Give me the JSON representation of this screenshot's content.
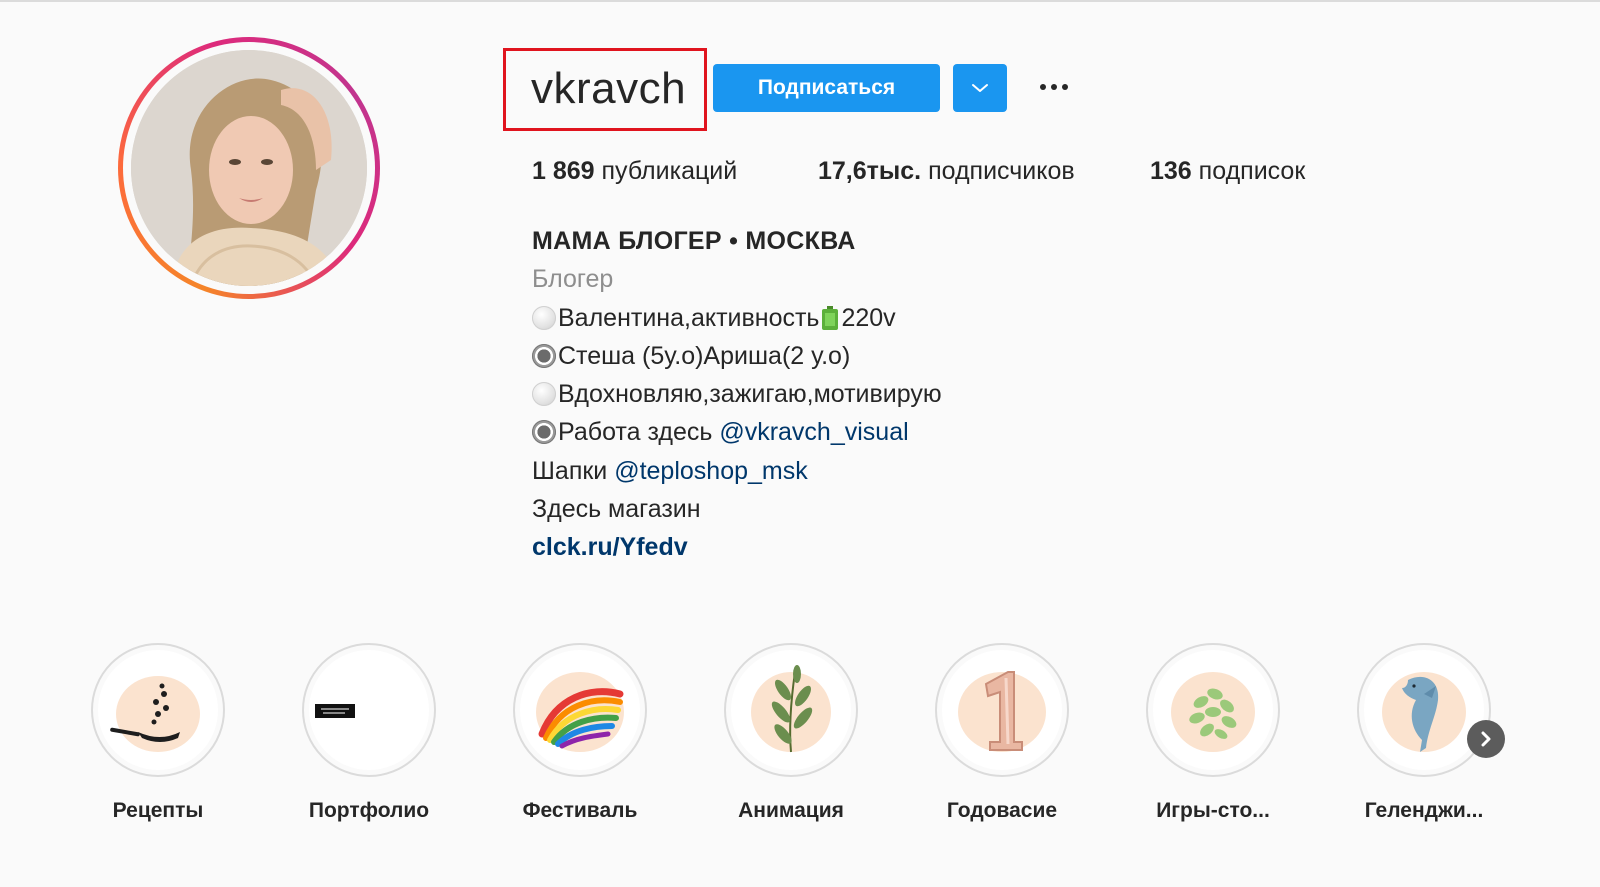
{
  "profile": {
    "username": "vkravch",
    "follow_label": "Подписаться",
    "dropdown_icon": "chevron-down-icon",
    "more_icon": "more-horizontal-icon"
  },
  "stats": {
    "posts_count": "1 869",
    "posts_label": "публикаций",
    "followers_count": "17,6тыс.",
    "followers_label": "подписчиков",
    "following_count": "136",
    "following_label": "подписок"
  },
  "bio": {
    "name": "МАМА БЛОГЕР • МОСКВА",
    "category": "Блогер",
    "line1_a": "Валентина,активность",
    "line1_b": "220v",
    "line2": "Стеша (5у.о)Ариша(2 у.о)",
    "line3": "Вдохновляю,зажигаю,мотивирую",
    "line4_prefix": "Работа здесь ",
    "line4_mention": "@vkravch_visual",
    "line5_prefix": "Шапки ",
    "line5_mention": "@teploshop_msk",
    "line6": "Здесь магазин",
    "link": "clck.ru/Yfedv"
  },
  "highlights": [
    {
      "label": "Рецепты",
      "icon": "frying-pan-icon"
    },
    {
      "label": "Портфолио",
      "icon": "label-icon"
    },
    {
      "label": "Фестиваль",
      "icon": "rainbow-icon"
    },
    {
      "label": "Анимация",
      "icon": "leaf-branch-icon"
    },
    {
      "label": "Годовасие",
      "icon": "number-one-balloon-icon"
    },
    {
      "label": "Игры-сто...",
      "icon": "green-plant-icon"
    },
    {
      "label": "Геленджи...",
      "icon": "dolphin-icon"
    }
  ],
  "colors": {
    "accent": "#1a96f0",
    "highlight_box": "#e0141e",
    "mention": "#00376b",
    "highlight_bg": "#fbe3cf"
  }
}
